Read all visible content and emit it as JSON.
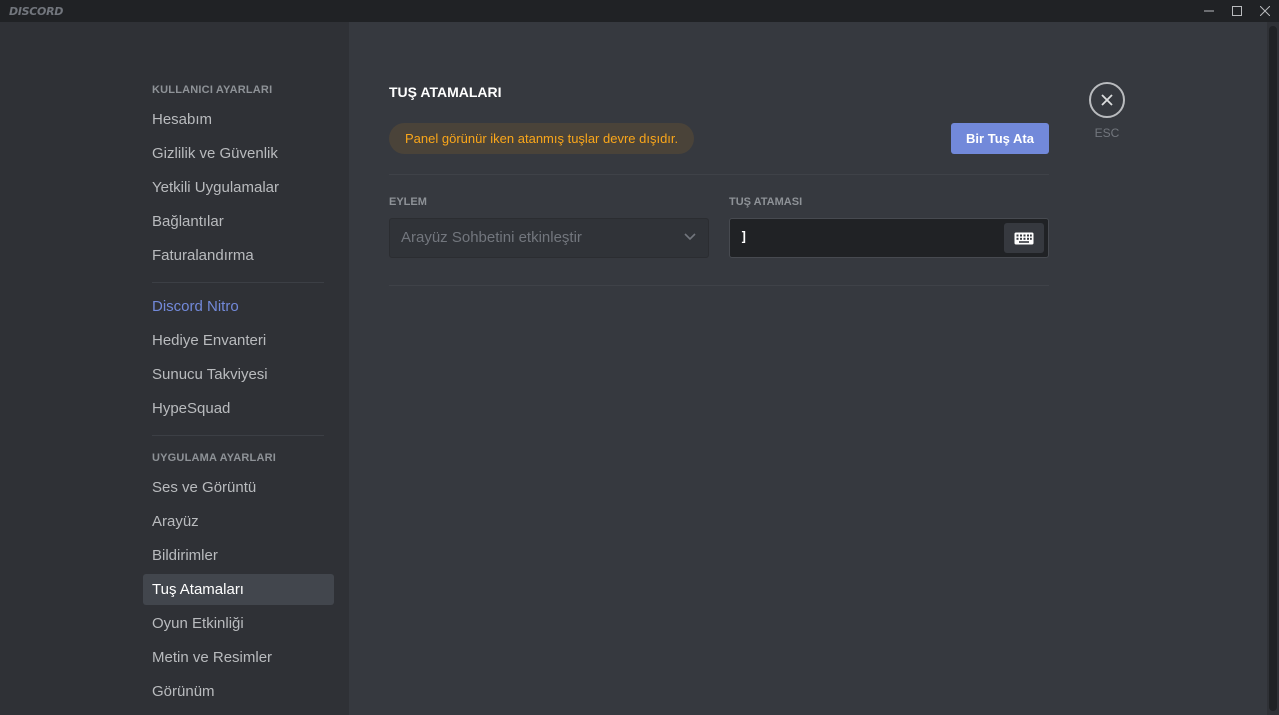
{
  "titlebar": {
    "brand": "DISCORD"
  },
  "sidebar": {
    "user_settings_header": "KULLANICI AYARLARI",
    "user_items": [
      "Hesabım",
      "Gizlilik ve Güvenlik",
      "Yetkili Uygulamalar",
      "Bağlantılar",
      "Faturalandırma"
    ],
    "nitro_items": [
      "Discord Nitro",
      "Hediye Envanteri",
      "Sunucu Takviyesi",
      "HypeSquad"
    ],
    "app_settings_header": "UYGULAMA AYARLARI",
    "app_items": [
      "Ses ve Görüntü",
      "Arayüz",
      "Bildirimler",
      "Tuş Atamaları",
      "Oyun Etkinliği",
      "Metin ve Resimler",
      "Görünüm"
    ],
    "active_item": "Tuş Atamaları"
  },
  "main": {
    "title": "TUŞ ATAMALARI",
    "warning": "Panel görünür iken atanmış tuşlar devre dışıdır.",
    "add_button": "Bir Tuş Ata",
    "action_label": "EYLEM",
    "keybind_label": "TUŞ ATAMASI",
    "action_value": "Arayüz Sohbetini etkinleştir",
    "keybind_value": "]",
    "close_label": "ESC"
  },
  "colors": {
    "accent": "#7289da",
    "warning": "#faa61a",
    "sidebar_bg": "#2f3136",
    "content_bg": "#36393f"
  }
}
